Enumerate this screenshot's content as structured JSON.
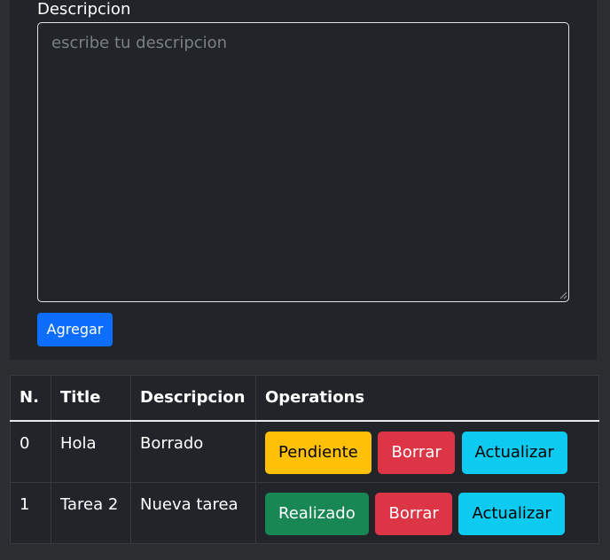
{
  "form": {
    "description_label": "Descripcion",
    "description_placeholder": "escribe tu descripcion",
    "description_value": "",
    "add_button": "Agregar"
  },
  "table": {
    "headers": [
      "N.",
      "Title",
      "Descripcion",
      "Operations"
    ],
    "rows": [
      {
        "number": "0",
        "title": "Hola",
        "description": "Borrado",
        "status_button": "Pendiente",
        "status_color": "#ffc107",
        "delete_button": "Borrar",
        "update_button": "Actualizar"
      },
      {
        "number": "1",
        "title": "Tarea 2",
        "description": "Nueva tarea",
        "status_button": "Realizado",
        "status_color": "#198754",
        "delete_button": "Borrar",
        "update_button": "Actualizar"
      }
    ]
  },
  "colors": {
    "primary": "#0d6efd",
    "warning": "#ffc107",
    "success": "#198754",
    "danger": "#dc3545",
    "info": "#0dcaf0",
    "surface": "#212529",
    "background": "#2b2d31"
  }
}
